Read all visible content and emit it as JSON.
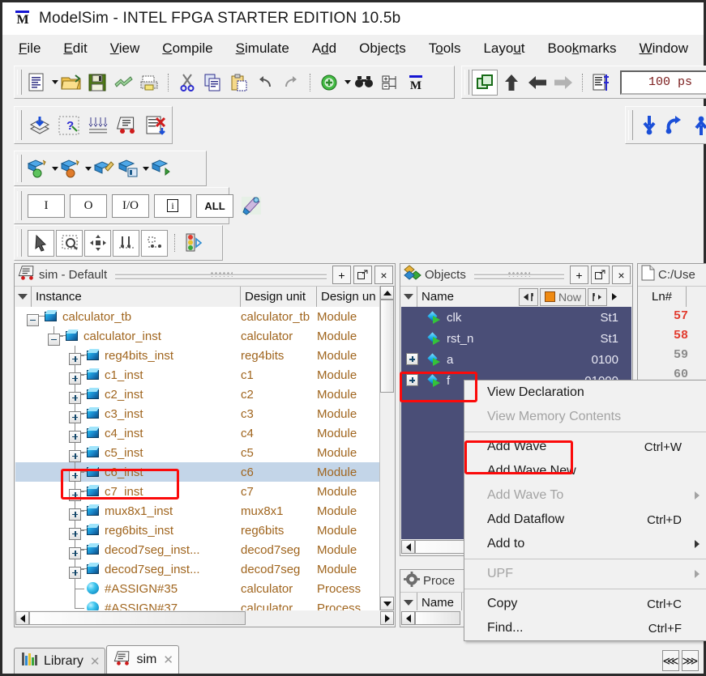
{
  "window": {
    "title": "ModelSim - INTEL FPGA STARTER EDITION 10.5b",
    "logo_letter": "M"
  },
  "menubar": {
    "items": [
      {
        "label": "File",
        "mnemonic": "F"
      },
      {
        "label": "Edit",
        "mnemonic": "E"
      },
      {
        "label": "View",
        "mnemonic": "V"
      },
      {
        "label": "Compile",
        "mnemonic": "C"
      },
      {
        "label": "Simulate",
        "mnemonic": "S"
      },
      {
        "label": "Add",
        "mnemonic": "d"
      },
      {
        "label": "Objects",
        "mnemonic": "t"
      },
      {
        "label": "Tools",
        "mnemonic": "o"
      },
      {
        "label": "Layout",
        "mnemonic": "u"
      },
      {
        "label": "Bookmarks",
        "mnemonic": "k"
      },
      {
        "label": "Window",
        "mnemonic": "W"
      }
    ]
  },
  "toolbar_main": {
    "icons": [
      "new-document-icon",
      "open-folder-icon",
      "save-icon",
      "reload-icon",
      "print-icon",
      "cut-icon",
      "copy-icon",
      "paste-icon",
      "undo-icon",
      "redo-icon",
      "add-item-icon",
      "find-icon",
      "expand-tree-icon",
      "modelsim-icon"
    ],
    "time_value": "100 ps"
  },
  "toolbar_sim_right": {
    "icons": [
      "compile-icon",
      "step-up-icon",
      "step-back-icon",
      "step-forward-icon",
      "source-icon"
    ]
  },
  "toolbar_wave": {
    "icons": [
      "layers-down-icon",
      "wizard-icon",
      "grid-icon",
      "sim-truck-icon",
      "clear-list-icon"
    ],
    "right_icons": [
      "down-arrow-icon",
      "restart-arrow-icon",
      "up-arrow-icon"
    ]
  },
  "toolbar_run": {
    "icons": [
      "run-icon",
      "run-continue-icon",
      "run-all-icon",
      "break-icon",
      "restart-icon",
      "run-next-icon"
    ]
  },
  "toolbar_filter": {
    "buttons": [
      "I",
      "O",
      "I/O",
      "i",
      "ALL"
    ],
    "extra_icon": "settings-wand-icon"
  },
  "toolbar_edit": {
    "icons": [
      "select-cursor-icon",
      "zoom-select-icon",
      "pan-icon",
      "zoom-range-icon",
      "zoom-region-icon",
      "signal-trace-icon"
    ]
  },
  "sim_panel": {
    "title": "sim - Default",
    "title_icon": "sim-truck-icon",
    "header_buttons": [
      "+",
      "undock",
      "×"
    ],
    "columns": [
      "Instance",
      "Design unit",
      "Design un"
    ],
    "rows": [
      {
        "instance": "calculator_tb",
        "design_unit": "calculator_tb",
        "type": "Module",
        "depth": 0,
        "expander": "minus",
        "icon": "module-icon",
        "selected": false
      },
      {
        "instance": "calculator_inst",
        "design_unit": "calculator",
        "type": "Module",
        "depth": 1,
        "expander": "minus",
        "icon": "module-icon",
        "selected": false
      },
      {
        "instance": "reg4bits_inst",
        "design_unit": "reg4bits",
        "type": "Module",
        "depth": 2,
        "expander": "plus",
        "icon": "module-icon",
        "selected": false
      },
      {
        "instance": "c1_inst",
        "design_unit": "c1",
        "type": "Module",
        "depth": 2,
        "expander": "plus",
        "icon": "module-icon",
        "selected": false
      },
      {
        "instance": "c2_inst",
        "design_unit": "c2",
        "type": "Module",
        "depth": 2,
        "expander": "plus",
        "icon": "module-icon",
        "selected": false
      },
      {
        "instance": "c3_inst",
        "design_unit": "c3",
        "type": "Module",
        "depth": 2,
        "expander": "plus",
        "icon": "module-icon",
        "selected": false
      },
      {
        "instance": "c4_inst",
        "design_unit": "c4",
        "type": "Module",
        "depth": 2,
        "expander": "plus",
        "icon": "module-icon",
        "selected": false
      },
      {
        "instance": "c5_inst",
        "design_unit": "c5",
        "type": "Module",
        "depth": 2,
        "expander": "plus",
        "icon": "module-icon",
        "selected": false
      },
      {
        "instance": "c6_inst",
        "design_unit": "c6",
        "type": "Module",
        "depth": 2,
        "expander": "plus",
        "icon": "module-icon",
        "selected": true
      },
      {
        "instance": "c7_inst",
        "design_unit": "c7",
        "type": "Module",
        "depth": 2,
        "expander": "plus",
        "icon": "module-icon",
        "selected": false
      },
      {
        "instance": "mux8x1_inst",
        "design_unit": "mux8x1",
        "type": "Module",
        "depth": 2,
        "expander": "plus",
        "icon": "module-icon",
        "selected": false
      },
      {
        "instance": "reg6bits_inst",
        "design_unit": "reg6bits",
        "type": "Module",
        "depth": 2,
        "expander": "plus",
        "icon": "module-icon",
        "selected": false
      },
      {
        "instance": "decod7seg_inst...",
        "design_unit": "decod7seg",
        "type": "Module",
        "depth": 2,
        "expander": "plus",
        "icon": "module-icon",
        "selected": false
      },
      {
        "instance": "decod7seg_inst...",
        "design_unit": "decod7seg",
        "type": "Module",
        "depth": 2,
        "expander": "plus",
        "icon": "module-icon",
        "selected": false
      },
      {
        "instance": "#ASSIGN#35",
        "design_unit": "calculator",
        "type": "Process",
        "depth": 2,
        "expander": "none",
        "icon": "process-icon",
        "selected": false
      },
      {
        "instance": "#ASSIGN#37",
        "design_unit": "calculator",
        "type": "Process",
        "depth": 2,
        "expander": "none",
        "icon": "process-icon",
        "selected": false
      }
    ]
  },
  "objects_panel": {
    "title": "Objects",
    "title_icon": "objects-icon",
    "header_buttons": [
      "+",
      "undock",
      "×"
    ],
    "column_name": "Name",
    "now_label": "Now",
    "rows": [
      {
        "name": "clk",
        "value": "St1",
        "expander": "none",
        "icon": "signal-icon"
      },
      {
        "name": "rst_n",
        "value": "St1",
        "expander": "none",
        "icon": "signal-icon"
      },
      {
        "name": "a",
        "value": "0100",
        "expander": "plus",
        "icon": "signal-icon"
      },
      {
        "name": "f",
        "value": "01000",
        "expander": "plus",
        "icon": "signal-bus-icon"
      }
    ]
  },
  "processes_panel": {
    "title": "Proce",
    "title_icon": "gear-icon",
    "column_name": "Name",
    "rows": [
      {
        "name": "#",
        "icon": "process-icon"
      },
      {
        "name": "#",
        "icon": "process-icon"
      }
    ]
  },
  "source_panel": {
    "title": "C:/Use",
    "title_icon": "file-icon",
    "column_header": "Ln#",
    "lines": [
      {
        "num": "57",
        "color": "#e23b2e"
      },
      {
        "num": "58",
        "color": "#e23b2e"
      },
      {
        "num": "59",
        "color": "#8a8a8a"
      },
      {
        "num": "60",
        "color": "#8a8a8a"
      }
    ]
  },
  "context_menu": {
    "items": [
      {
        "label": "View Declaration",
        "accel": "",
        "disabled": false,
        "submenu": false
      },
      {
        "label": "View Memory Contents",
        "accel": "",
        "disabled": true,
        "submenu": false
      },
      {
        "separator": true
      },
      {
        "label": "Add Wave",
        "accel": "Ctrl+W",
        "disabled": false,
        "submenu": false,
        "highlighted": true
      },
      {
        "label": "Add Wave New",
        "accel": "",
        "disabled": false,
        "submenu": false
      },
      {
        "label": "Add Wave To",
        "accel": "",
        "disabled": true,
        "submenu": true
      },
      {
        "label": "Add Dataflow",
        "accel": "Ctrl+D",
        "disabled": false,
        "submenu": false
      },
      {
        "label": "Add to",
        "accel": "",
        "disabled": false,
        "submenu": true
      },
      {
        "separator": true
      },
      {
        "label": "UPF",
        "accel": "",
        "disabled": true,
        "submenu": true
      },
      {
        "separator": true
      },
      {
        "label": "Copy",
        "accel": "Ctrl+C",
        "disabled": false,
        "submenu": false
      },
      {
        "label": "Find...",
        "accel": "Ctrl+F",
        "disabled": false,
        "submenu": false
      }
    ]
  },
  "bottom_tabs": {
    "tabs": [
      {
        "label": "Library",
        "icon": "library-icon",
        "active": false
      },
      {
        "label": "sim",
        "icon": "sim-truck-icon",
        "active": true
      }
    ]
  },
  "annotations": {
    "accent_color": "#fb0a0a",
    "boxes": [
      "c6_inst-row",
      "objects-f-row",
      "add-wave-menu-item"
    ]
  }
}
